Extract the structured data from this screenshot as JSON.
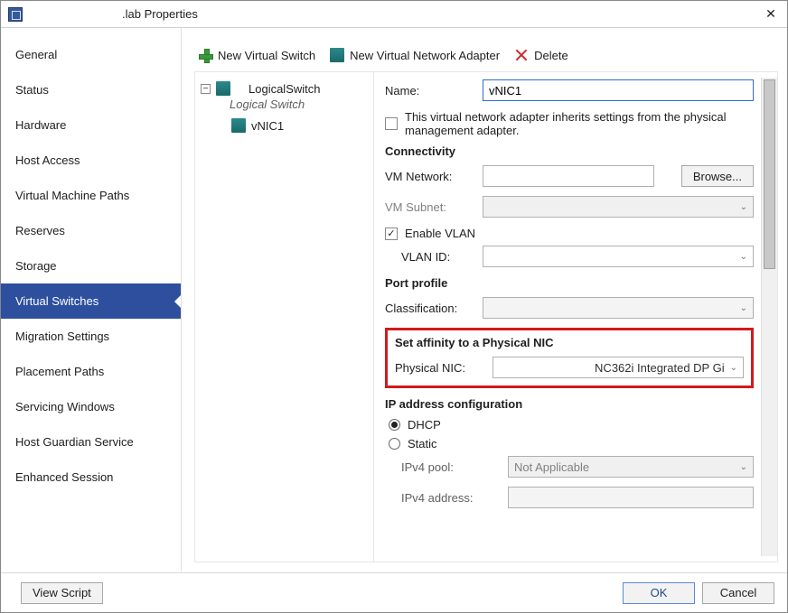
{
  "window": {
    "title": ".lab Properties"
  },
  "nav": {
    "items": [
      {
        "label": "General"
      },
      {
        "label": "Status"
      },
      {
        "label": "Hardware"
      },
      {
        "label": "Host Access"
      },
      {
        "label": "Virtual Machine Paths"
      },
      {
        "label": "Reserves"
      },
      {
        "label": "Storage"
      },
      {
        "label": "Virtual Switches"
      },
      {
        "label": "Migration Settings"
      },
      {
        "label": "Placement Paths"
      },
      {
        "label": "Servicing Windows"
      },
      {
        "label": "Host Guardian Service"
      },
      {
        "label": "Enhanced Session"
      }
    ]
  },
  "toolbar": {
    "newSwitch": "New Virtual Switch",
    "newAdapter": "New Virtual Network Adapter",
    "delete": "Delete"
  },
  "tree": {
    "rootLabel": "LogicalSwitch",
    "rootType": "Logical Switch",
    "child1": "vNIC1",
    "expander": "−"
  },
  "form": {
    "nameLabel": "Name:",
    "nameValue": "vNIC1",
    "inheritText": "This virtual network adapter inherits settings from the physical management adapter.",
    "connectivityHdr": "Connectivity",
    "vmNetworkLabel": "VM Network:",
    "browse": "Browse...",
    "vmSubnetLabel": "VM Subnet:",
    "enableVlan": "Enable VLAN",
    "vlanIdLabel": "VLAN ID:",
    "portProfileHdr": "Port profile",
    "classificationLabel": "Classification:",
    "affinityHdr": "Set affinity to a Physical NIC",
    "physicalNicLabel": "Physical NIC:",
    "physicalNicValue": "NC362i Integrated DP Gi",
    "ipHdr": "IP address configuration",
    "dhcp": "DHCP",
    "static": "Static",
    "ipv4PoolLabel": "IPv4 pool:",
    "ipv4PoolValue": "Not Applicable",
    "ipv4AddrLabel": "IPv4 address:"
  },
  "footer": {
    "viewScript": "View Script",
    "ok": "OK",
    "cancel": "Cancel"
  }
}
